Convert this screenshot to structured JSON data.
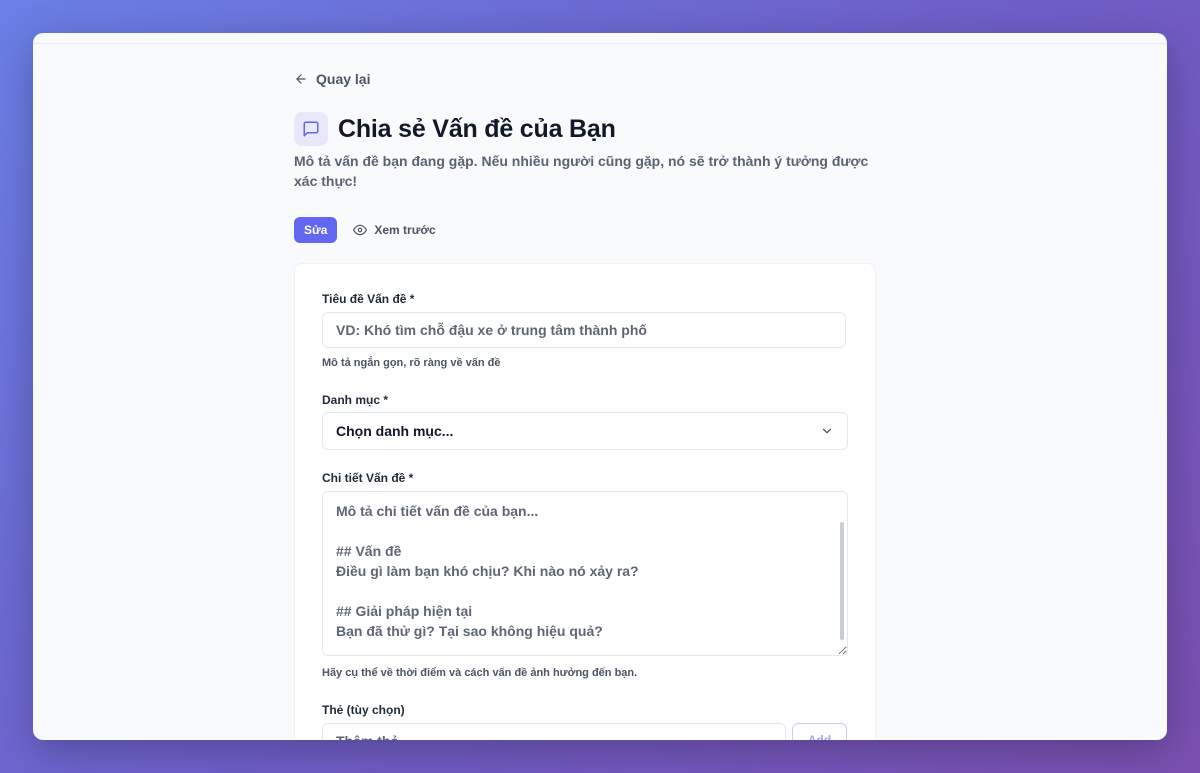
{
  "nav": {
    "back_label": "Quay lại"
  },
  "header": {
    "title": "Chia sẻ Vấn đề của Bạn",
    "subtitle": "Mô tả vấn đề bạn đang gặp. Nếu nhiều người cũng gặp, nó sẽ trở thành ý tưởng được xác thực!"
  },
  "tabs": {
    "edit_label": "Sửa",
    "preview_label": "Xem trước"
  },
  "form": {
    "title_field": {
      "label": "Tiêu đề Vấn đề *",
      "placeholder": "VD: Khó tìm chỗ đậu xe ở trung tâm thành phố",
      "helper": "Mô tả ngắn gọn, rõ ràng về vấn đề"
    },
    "category_field": {
      "label": "Danh mục *",
      "selected": "Chọn danh mục..."
    },
    "details_field": {
      "label": "Chi tiết Vấn đề *",
      "placeholder": "Mô tả chi tiết vấn đề của bạn...\n\n## Vấn đề\nĐiều gì làm bạn khó chịu? Khi nào nó xảy ra?\n\n## Giải pháp hiện tại\nBạn đã thử gì? Tại sao không hiệu quả?",
      "helper": "Hãy cụ thể về thời điểm và cách vấn đề ảnh hưởng đến bạn."
    },
    "tags_field": {
      "label": "Thẻ (tùy chọn)",
      "placeholder": "Thêm thẻ...",
      "add_label": "Add"
    }
  },
  "colors": {
    "accent": "#6366f1",
    "background_start": "#6a7fe6",
    "background_end": "#7a4fb0"
  }
}
